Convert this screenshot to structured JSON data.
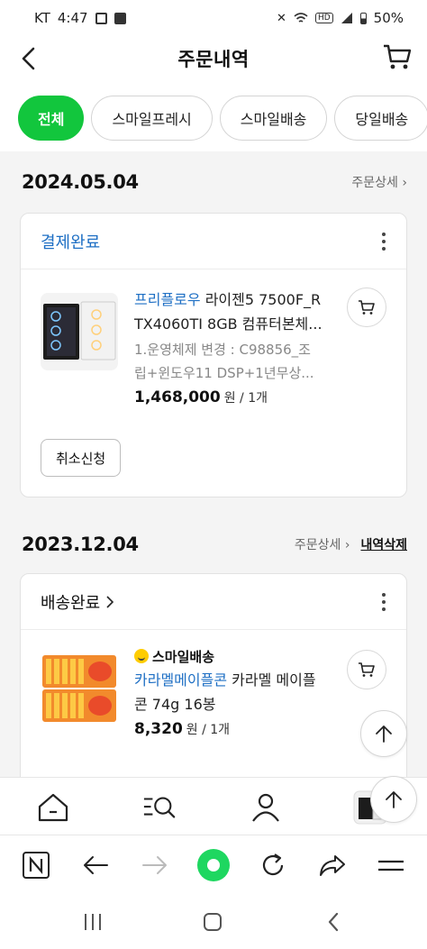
{
  "status_bar": {
    "carrier": "KT",
    "time": "4:47",
    "battery": "50%"
  },
  "header": {
    "title": "주문내역"
  },
  "tabs": [
    {
      "label": "전체",
      "active": true
    },
    {
      "label": "스마일프레시",
      "active": false
    },
    {
      "label": "스마일배송",
      "active": false
    },
    {
      "label": "당일배송",
      "active": false
    }
  ],
  "orders": [
    {
      "date": "2024.05.04",
      "detail_link": "주문상세 ›",
      "status": "결제완료",
      "item": {
        "brand": "프리플로우",
        "name_line1": " 라이젠5 7500F_R",
        "name_line2": "TX4060TI 8GB 컴퓨터본체...",
        "option_line1": "1.운영체제 변경 : C98856_조",
        "option_line2": "립+윈도우11 DSP+1년무상...",
        "price": "1,468,000",
        "unit": "원 / 1개"
      },
      "cancel_label": "취소신청"
    },
    {
      "date": "2023.12.04",
      "detail_link": "주문상세 ›",
      "delete_link": "내역삭제",
      "status": "배송완료",
      "item": {
        "badge": "스마일배송",
        "brand": "카라멜메이플콘",
        "name_line1": " 카라멜 메이플",
        "name_line2": "콘 74g 16봉",
        "price": "8,320",
        "unit": "원 / 1개"
      }
    }
  ],
  "colors": {
    "accent_green": "#12c63d",
    "link_blue": "#1e6fc4",
    "browser_green": "#1ed760"
  }
}
